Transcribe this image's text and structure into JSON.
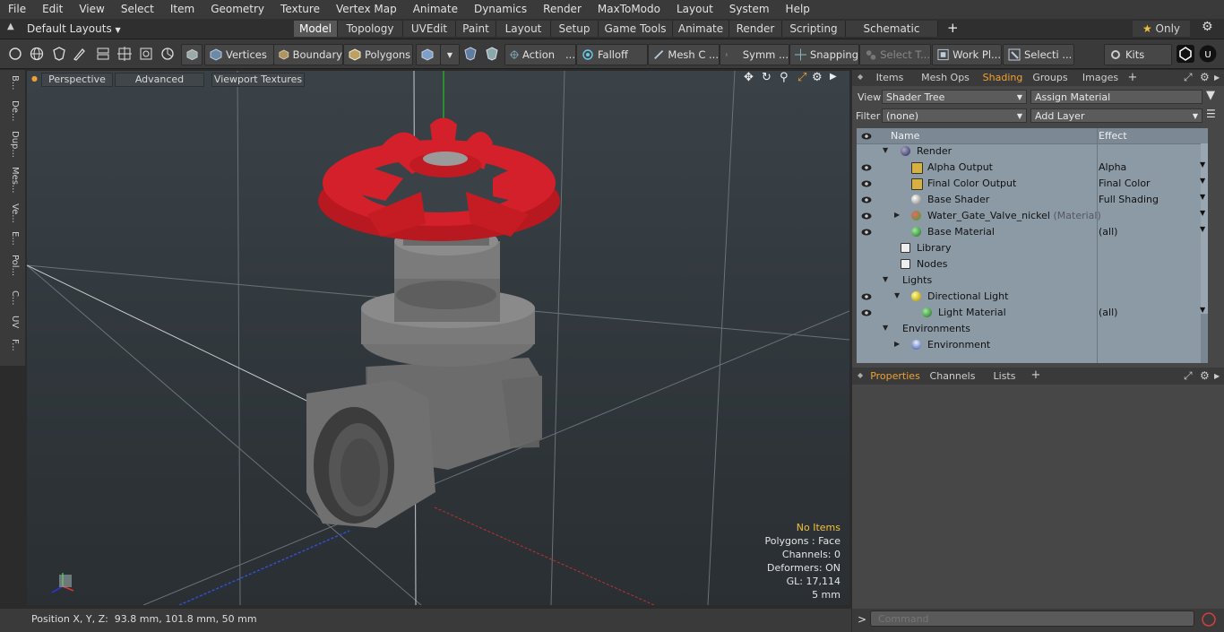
{
  "menu": [
    "File",
    "Edit",
    "View",
    "Select",
    "Item",
    "Geometry",
    "Texture",
    "Vertex Map",
    "Animate",
    "Dynamics",
    "Render",
    "MaxToModo",
    "Layout",
    "System",
    "Help"
  ],
  "layout_bar": {
    "layout_select": "Default Layouts",
    "tabs": [
      "Model",
      "Topology",
      "UVEdit",
      "Paint",
      "Layout",
      "Setup",
      "Game Tools",
      "Animate",
      "Render",
      "Scripting",
      "Schematic Fusion"
    ],
    "active_tab": "Model",
    "add_label": "+",
    "only_label": "Only"
  },
  "toolbar": {
    "vertices": "Vertices",
    "boundary": "Boundary",
    "polygons": "Polygons",
    "action": "Action",
    "falloff": "Falloff",
    "mesh_c": "Mesh C ...",
    "symm": "Symm ...",
    "snapping": "Snapping",
    "select_t": "Select T...",
    "work_pl": "Work Pl...",
    "selecti": "Selecti ...",
    "kits": "Kits",
    "ellipsis": "..."
  },
  "left_tabs": [
    "B...",
    "De...",
    "Dup...",
    "Mes...",
    "Ve...",
    "E...",
    "Pol...",
    "C...",
    "UV",
    "F..."
  ],
  "viewport": {
    "perspective": "Perspective",
    "advanced": "Advanced",
    "textures": "Viewport Textures",
    "info": {
      "no_items": "No Items",
      "polygons": "Polygons : Face",
      "channels": "Channels: 0",
      "deformers": "Deformers: ON",
      "gl": "GL: 17,114",
      "scale": "5 mm"
    }
  },
  "shader_panel": {
    "tabs": [
      "Items",
      "Mesh Ops",
      "Shading",
      "Groups",
      "Images"
    ],
    "active_tab": "Shading",
    "add_label": "+",
    "view_label": "View",
    "view_value": "Shader Tree",
    "assign_material": "Assign Material",
    "filter_label": "Filter",
    "filter_value": "(none)",
    "add_layer": "Add Layer",
    "col_name": "Name",
    "col_effect": "Effect",
    "rows": [
      {
        "name": "Render",
        "effect": "",
        "suffix": ""
      },
      {
        "name": "Alpha Output",
        "effect": "Alpha",
        "suffix": ""
      },
      {
        "name": "Final Color Output",
        "effect": "Final Color",
        "suffix": ""
      },
      {
        "name": "Base Shader",
        "effect": "Full Shading",
        "suffix": ""
      },
      {
        "name": "Water_Gate_Valve_nickel",
        "effect": "",
        "suffix": "(Material)"
      },
      {
        "name": "Base Material",
        "effect": "(all)",
        "suffix": ""
      },
      {
        "name": "Library",
        "effect": "",
        "suffix": ""
      },
      {
        "name": "Nodes",
        "effect": "",
        "suffix": ""
      },
      {
        "name": "Lights",
        "effect": "",
        "suffix": ""
      },
      {
        "name": "Directional Light",
        "effect": "",
        "suffix": ""
      },
      {
        "name": "Light Material",
        "effect": "(all)",
        "suffix": ""
      },
      {
        "name": "Environments",
        "effect": "",
        "suffix": ""
      },
      {
        "name": "Environment",
        "effect": "",
        "suffix": ""
      }
    ]
  },
  "properties_panel": {
    "tabs": [
      "Properties",
      "Channels",
      "Lists"
    ],
    "active_tab": "Properties",
    "add_label": "+"
  },
  "status": {
    "position": "Position X, Y, Z:  93.8 mm, 101.8 mm, 50 mm"
  },
  "command": {
    "prompt": ">",
    "placeholder": "Command"
  },
  "colors": {
    "accent": "#f0a030",
    "handwheel": "#d4202a",
    "valve_body": "#7d7d7d"
  }
}
